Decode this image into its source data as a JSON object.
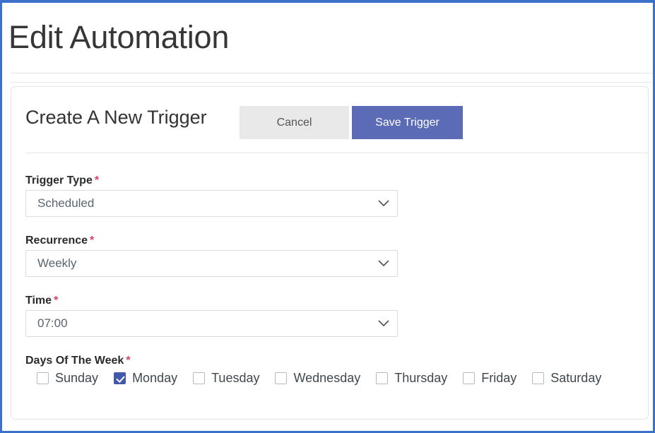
{
  "page": {
    "title": "Edit Automation"
  },
  "card": {
    "title": "Create A New Trigger",
    "cancel_label": "Cancel",
    "save_label": "Save Trigger"
  },
  "form": {
    "required_marker": "*",
    "fields": [
      {
        "label": "Trigger Type",
        "required": true,
        "type": "select",
        "value": "Scheduled"
      },
      {
        "label": "Recurrence",
        "required": true,
        "type": "select",
        "value": "Weekly"
      },
      {
        "label": "Time",
        "required": true,
        "type": "select",
        "value": "07:00"
      }
    ],
    "days_label": "Days Of The Week",
    "days": [
      {
        "label": "Sunday",
        "checked": false
      },
      {
        "label": "Monday",
        "checked": true
      },
      {
        "label": "Tuesday",
        "checked": false
      },
      {
        "label": "Wednesday",
        "checked": false
      },
      {
        "label": "Thursday",
        "checked": false
      },
      {
        "label": "Friday",
        "checked": false
      },
      {
        "label": "Saturday",
        "checked": false
      }
    ]
  },
  "colors": {
    "primary": "#5b6bb5",
    "checkbox_checked": "#4259a9",
    "required_red": "#d9435e",
    "viewport_border": "#3b71ca",
    "cancel_bg": "#e9e9e9"
  },
  "icons": {
    "chevron_down": "chevron-down-icon",
    "check": "check-icon"
  }
}
